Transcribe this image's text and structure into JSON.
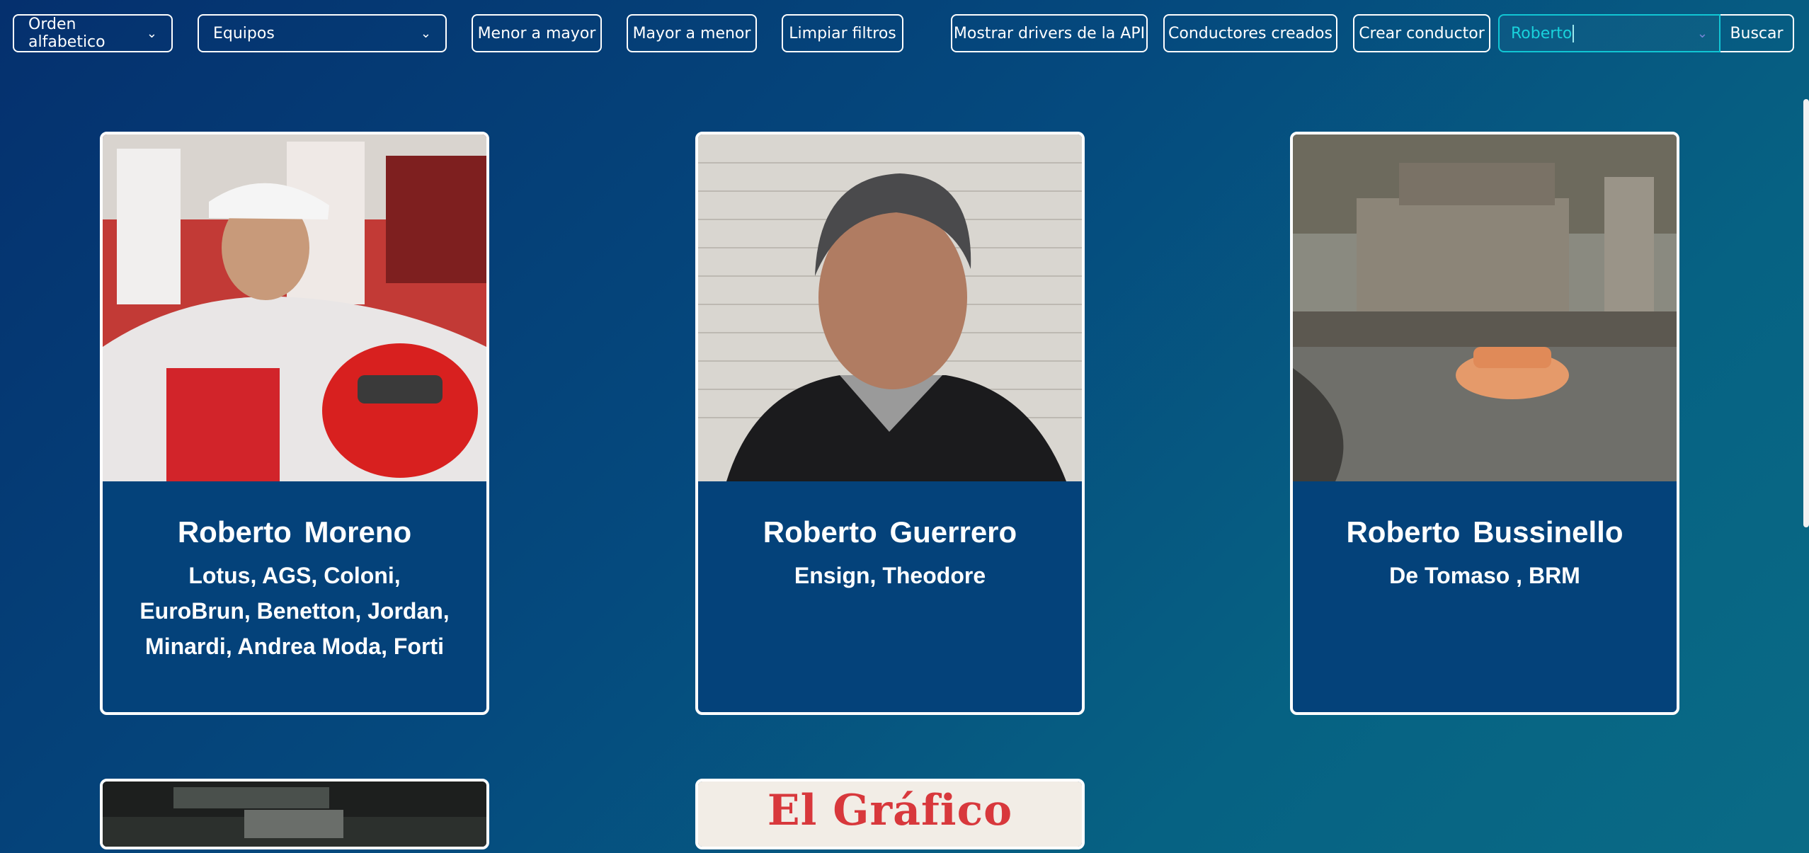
{
  "toolbar": {
    "sort_select": "Orden alfabetico",
    "teams_select": "Equipos",
    "asc_button": "Menor a mayor",
    "desc_button": "Mayor a menor",
    "clear_button": "Limpiar filtros",
    "api_button": "Mostrar drivers de la API",
    "created_button": "Conductores creados",
    "create_button": "Crear conductor",
    "search_value": "Roberto",
    "search_button": "Buscar"
  },
  "cards": [
    {
      "name": "Roberto  Moreno",
      "teams": "Lotus, AGS, Coloni, EuroBrun, Benetton, Jordan, Minardi, Andrea Moda, Forti"
    },
    {
      "name": "Roberto  Guerrero",
      "teams": "Ensign, Theodore"
    },
    {
      "name": "Roberto  Bussinello",
      "teams": "De Tomaso , BRM"
    }
  ],
  "partial_cards": [
    {
      "photo_text": ""
    },
    {
      "photo_text": "El Gráfico"
    }
  ],
  "icons": {
    "select_chevron": "chevron-down-icon"
  },
  "colors": {
    "background_start": "#05306e",
    "background_end": "#0a6b86",
    "card_body": "#04427a",
    "accent_cyan": "#11c6d4",
    "magazine_red": "#d8383c"
  }
}
